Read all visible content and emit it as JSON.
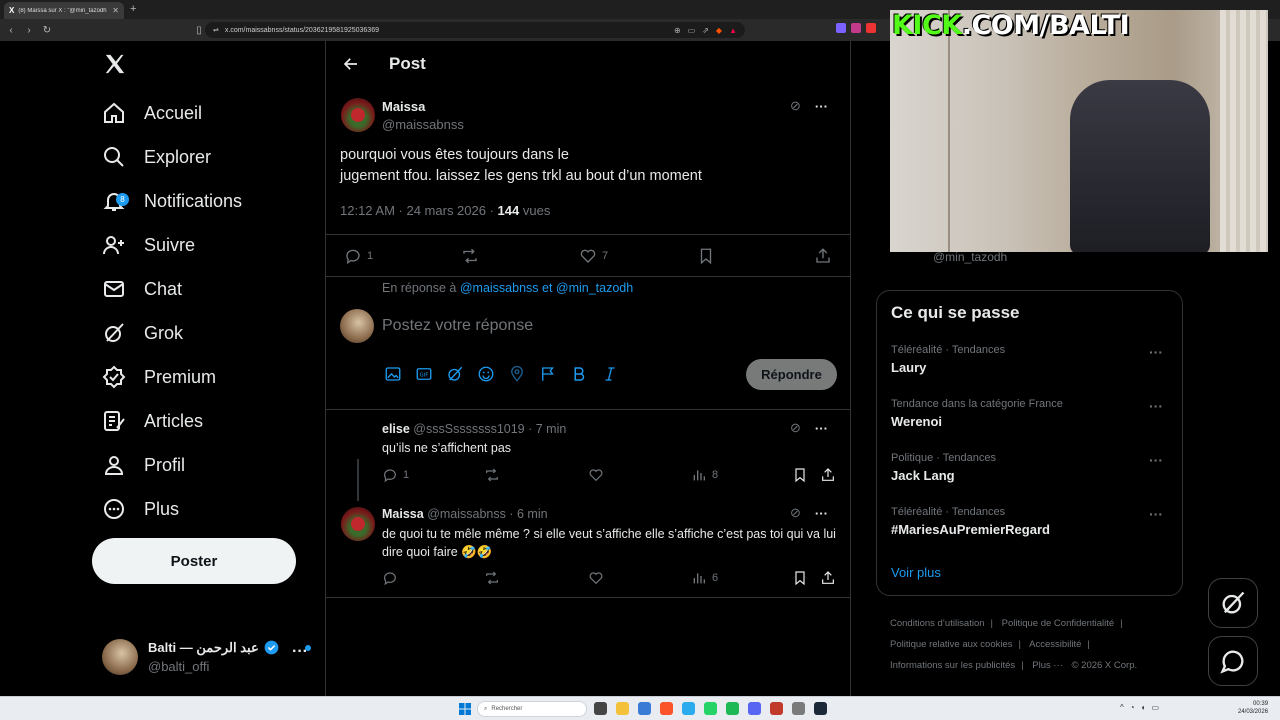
{
  "browser": {
    "tab_title": "(8) Maïssa sur X : \"@min_tazodh ...",
    "url": "x.com/maissabnss/status/2036219581925036369",
    "new_tab": "+"
  },
  "nav": {
    "items": [
      {
        "label": "Accueil"
      },
      {
        "label": "Explorer"
      },
      {
        "label": "Notifications",
        "badge": "8"
      },
      {
        "label": "Suivre"
      },
      {
        "label": "Chat"
      },
      {
        "label": "Grok"
      },
      {
        "label": "Premium"
      },
      {
        "label": "Articles"
      },
      {
        "label": "Profil"
      },
      {
        "label": "Plus"
      }
    ],
    "post_button": "Poster",
    "account": {
      "name": "Balti — عبد الرحمن",
      "handle": "@balti_offi",
      "more": "···"
    }
  },
  "post": {
    "header_title": "Post",
    "author_name": "Maissa",
    "author_handle": "@maissabnss",
    "text_line1": "pourquoi vous êtes toujours dans le",
    "text_line2": "jugement tfou. laissez les gens trkl au bout d’un moment",
    "time": "12:12 AM · 24 mars 2026 ·",
    "views_count": "144",
    "views_label": "vues",
    "replies": "1",
    "likes": "7"
  },
  "composer": {
    "reply_prefix": "En réponse à",
    "reply_handles": "@maissabnss et @min_tazodh",
    "placeholder": "Postez votre réponse",
    "submit": "Répondre"
  },
  "replies": [
    {
      "name": "elise",
      "handle": "@sssSsssssss1019",
      "time": "· 7 min",
      "text": "qu’ils ne s’affichent pas",
      "replies": "1",
      "views": "8"
    },
    {
      "name": "Maissa",
      "handle": "@maissabnss",
      "time": "· 6 min",
      "text": "de quoi tu te mêle même ? si elle veut s’affiche elle s’affiche c’est pas toi qui va lui dire quoi faire 🤣🤣",
      "replies": "",
      "views": "6"
    }
  ],
  "trends": {
    "title": "Ce qui se passe",
    "items": [
      {
        "category": "Téléréalité · Tendances",
        "name": "Laury"
      },
      {
        "category": "Tendance dans la catégorie France",
        "name": "Werenoi"
      },
      {
        "category": "Politique · Tendances",
        "name": "Jack Lang"
      },
      {
        "category": "Téléréalité · Tendances",
        "name": "#MariesAuPremierRegard"
      }
    ],
    "see_more": "Voir plus"
  },
  "footer": {
    "links": [
      "Conditions d’utilisation",
      "|",
      "Politique de Confidentialité",
      "|",
      "Politique relative aux cookies",
      "|",
      "Accessibilité",
      "|",
      "Informations sur les publicités",
      "|",
      "Plus ···",
      "© 2026 X Corp."
    ]
  },
  "overlay": {
    "kick_green": "KICK",
    "kick_white": ".COM/BALTI",
    "peek_handle": "@min_tazodh"
  },
  "taskbar": {
    "search": "Rechercher",
    "time": "00:39",
    "date": "24/03/2026"
  },
  "colors": {
    "accent": "#1d9bf0",
    "kick": "#53fc18",
    "background": "#000000"
  }
}
